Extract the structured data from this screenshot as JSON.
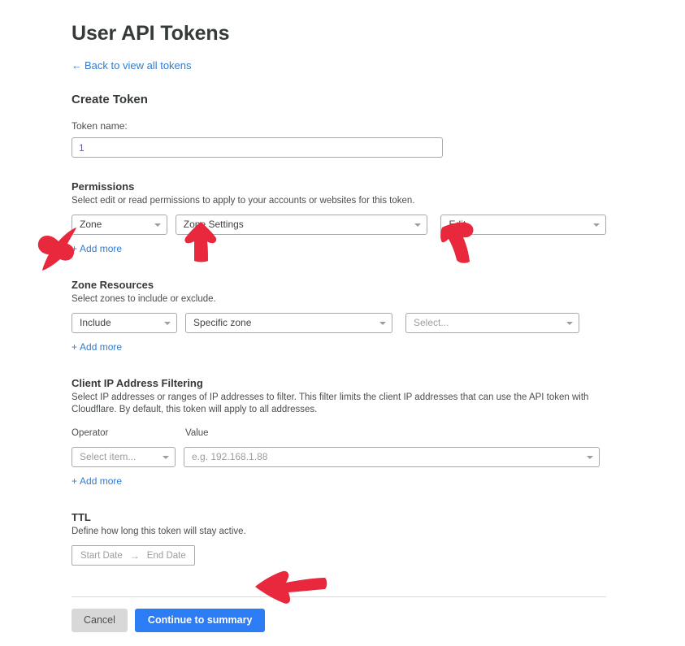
{
  "page": {
    "title": "User API Tokens",
    "back_link": "Back to view all tokens",
    "back_arrow_glyph": "←",
    "section_title": "Create Token"
  },
  "token_name": {
    "label": "Token name:",
    "value": "1",
    "placeholder": ""
  },
  "permissions": {
    "heading": "Permissions",
    "description": "Select edit or read permissions to apply to your accounts or websites for this token.",
    "scope_value": "Zone",
    "group_value": "Zone Settings",
    "level_value": "Edit",
    "add_more": "Add more",
    "plus_glyph": "+"
  },
  "zone_resources": {
    "heading": "Zone Resources",
    "description": "Select zones to include or exclude.",
    "mode_value": "Include",
    "type_value": "Specific zone",
    "value_placeholder": "Select...",
    "add_more": "Add more",
    "plus_glyph": "+"
  },
  "client_ip": {
    "heading": "Client IP Address Filtering",
    "description": "Select IP addresses or ranges of IP addresses to filter. This filter limits the client IP addresses that can use the API token with Cloudflare. By default, this token will apply to all addresses.",
    "operator_label": "Operator",
    "value_label": "Value",
    "operator_placeholder": "Select item...",
    "value_placeholder": "e.g. 192.168.1.88",
    "add_more": "Add more",
    "plus_glyph": "+"
  },
  "ttl": {
    "heading": "TTL",
    "description": "Define how long this token will stay active.",
    "start_date": "Start Date",
    "end_date": "End Date",
    "separator_glyph": "→"
  },
  "footer": {
    "cancel_label": "Cancel",
    "continue_label": "Continue to summary"
  },
  "colors": {
    "link": "#2f7cd6",
    "primary_button": "#2c7cf6",
    "annotation_red": "#e8283c",
    "border": "#a7a9ab",
    "placeholder_text": "#9a9da0"
  },
  "annotations": {
    "arrow_permissions_scope": "up-right-arrow",
    "arrow_permissions_group": "up-arrow",
    "arrow_permissions_level": "up-left-arrow",
    "arrow_continue_button": "left-arrow"
  }
}
